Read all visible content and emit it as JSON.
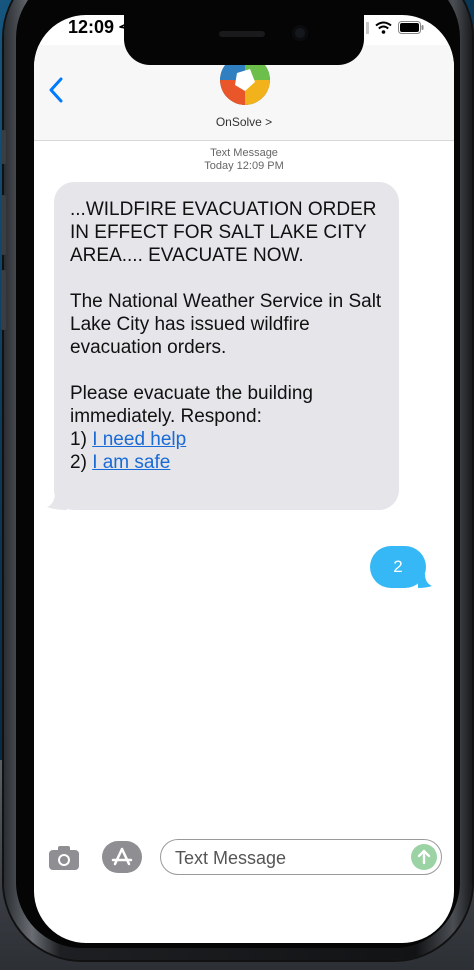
{
  "status_bar": {
    "time": "12:09"
  },
  "header": {
    "contact_name": "OnSolve >"
  },
  "thread": {
    "meta_type": "Text Message",
    "meta_time": "Today 12:09 PM",
    "incoming": {
      "p1": "...WILDFIRE EVACUATION ORDER IN EFFECT FOR SALT LAKE CITY AREA.... EVACUATE NOW.",
      "p2": "The National Weather Service in Salt Lake City has issued wildfire evacuation orders.",
      "p3_line1": "Please evacuate the building immediately. Respond:",
      "opt1_prefix": "1) ",
      "opt1_link": "I need help",
      "opt2_prefix": "2) ",
      "opt2_link": "I am safe"
    },
    "outgoing": {
      "text": "2"
    }
  },
  "input": {
    "placeholder": "Text Message"
  },
  "colors": {
    "incoming_bubble": "#e5e5ea",
    "outgoing_bubble": "#35b8f5",
    "link": "#1a6ad6",
    "accent": "#007aff",
    "send_button": "#9bd3a4"
  }
}
